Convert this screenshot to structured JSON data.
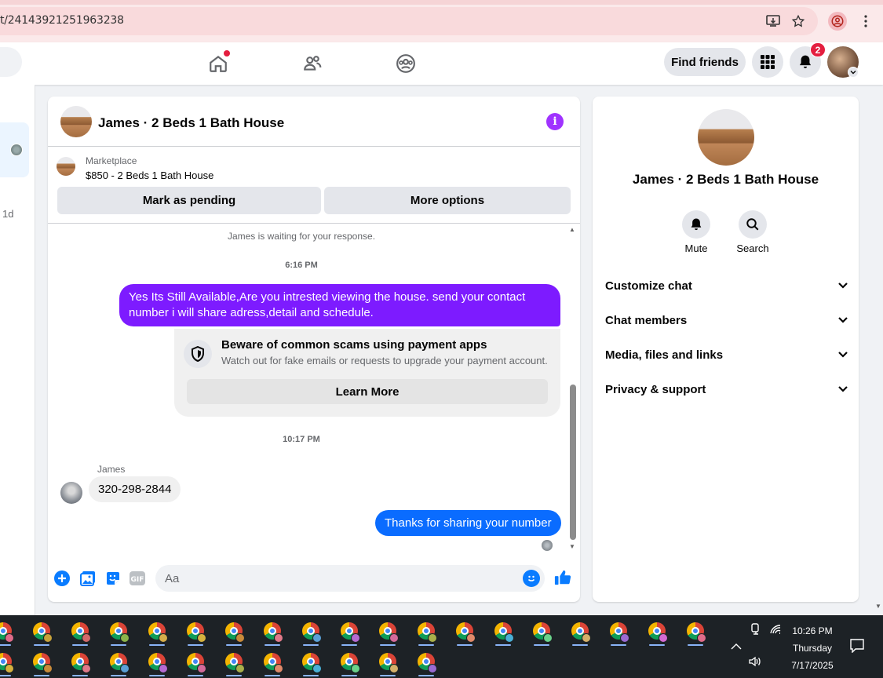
{
  "browser": {
    "url": "t/24143921251963238"
  },
  "fb_nav": {
    "find_friends": "Find friends",
    "notifications_count": "2"
  },
  "sidebar": {
    "time_ago": "1d"
  },
  "chat": {
    "title": "James · 2 Beds 1 Bath House",
    "marketplace_label": "Marketplace",
    "listing": "$850 - 2 Beds 1 Bath House",
    "mark_pending": "Mark as pending",
    "more_options": "More options",
    "waiting_notice": "James is waiting for your response.",
    "time_1": "6:16 PM",
    "out_message_1": "Yes Its Still Available,Are you intrested viewing the house. send your contact number i will share adress,detail and schedule.",
    "scam_title": "Beware of common scams using payment apps",
    "scam_subtitle": "Watch out for fake emails or requests to upgrade your payment account.",
    "learn_more": "Learn More",
    "time_2": "10:17 PM",
    "sender_name": "James",
    "in_message_1": "320-298-2844",
    "out_message_2": "Thanks for sharing your number",
    "composer_placeholder": "Aa"
  },
  "details_panel": {
    "title": "James · 2 Beds 1 Bath House",
    "mute": "Mute",
    "search": "Search",
    "sections": [
      "Customize chat",
      "Chat members",
      "Media, files and links",
      "Privacy & support"
    ]
  },
  "taskbar": {
    "time": "10:26 PM",
    "day": "Thursday",
    "date": "7/17/2025"
  },
  "colors": {
    "accent_purple": "#7d1bff",
    "messenger_blue": "#0a6cff",
    "notification_red": "#e41e3f",
    "fb_blue": "#0a7cff"
  }
}
